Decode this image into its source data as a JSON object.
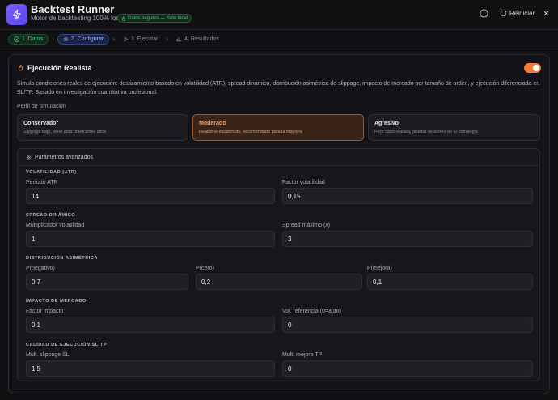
{
  "header": {
    "title": "Backtest Runner",
    "subtitle": "Motor de backtesting 100% local",
    "secure_badge": "Datos seguros — Solo local",
    "reset_label": "Reiniciar"
  },
  "stepper": {
    "steps": [
      {
        "label": "1. Datos",
        "state": "done"
      },
      {
        "label": "2. Configurar",
        "state": "active"
      },
      {
        "label": "3. Ejecutar",
        "state": "pending"
      },
      {
        "label": "4. Resultados",
        "state": "pending"
      }
    ]
  },
  "realistic": {
    "title": "Ejecución Realista",
    "enabled": true,
    "description": "Simula condiciones reales de ejecución: deslizamiento basado en volatilidad (ATR), spread dinámico, distribución asimétrica de slippage, impacto de mercado por tamaño de orden, y ejecución diferenciada en SL/TP. Basado en investigación cuantitativa profesional.",
    "profile_label": "Perfil de simulación",
    "profiles": [
      {
        "title": "Conservador",
        "desc": "Slippage bajo, ideal para timeframes altos"
      },
      {
        "title": "Moderado",
        "desc": "Realismo equilibrado, recomendado para la mayoría"
      },
      {
        "title": "Agresivo",
        "desc": "Peor caso realista, prueba de estrés de tu estrategia"
      }
    ],
    "selected_profile": "Moderado"
  },
  "advanced": {
    "title": "Parámetros avanzados",
    "volatility": {
      "title": "VOLATILIDAD (ATR)",
      "atr_period_label": "Período ATR",
      "atr_period": "14",
      "vol_factor_label": "Factor volatilidad",
      "vol_factor": "0,15"
    },
    "spread": {
      "title": "SPREAD DINÁMICO",
      "vol_mult_label": "Multiplicador volatilidad",
      "vol_mult": "1",
      "max_spread_label": "Spread máximo (x)",
      "max_spread": "3"
    },
    "distribution": {
      "title": "DISTRIBUCIÓN ASIMÉTRICA",
      "p_neg_label": "P(negativo)",
      "p_neg": "0,7",
      "p_zero_label": "P(cero)",
      "p_zero": "0,2",
      "p_better_label": "P(mejora)",
      "p_better": "0,1"
    },
    "impact": {
      "title": "IMPACTO DE MERCADO",
      "factor_label": "Factor impacto",
      "factor": "0,1",
      "ref_vol_label": "Vol. referencia (0=auto)",
      "ref_vol": "0"
    },
    "sltp": {
      "title": "CALIDAD DE EJECUCIÓN SL/TP",
      "sl_mult_label": "Mult. slippage SL",
      "sl_mult": "1,5",
      "tp_mult_label": "Mult. mejora TP",
      "tp_mult": "0"
    }
  },
  "colors": {
    "accent": "#f27f35",
    "brand": "#6a52f5",
    "success": "#4ed07a"
  }
}
